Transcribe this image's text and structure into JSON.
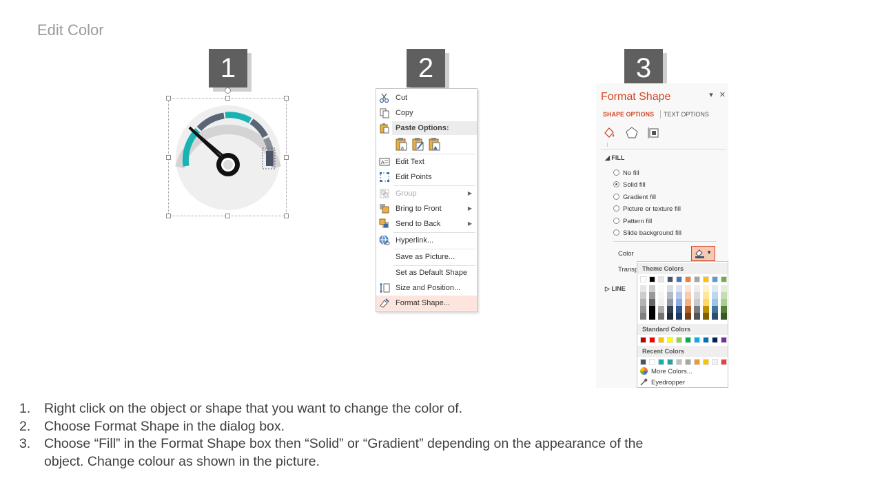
{
  "title": "Edit Color",
  "steps": [
    "1",
    "2",
    "3"
  ],
  "context_menu": {
    "items": [
      {
        "label": "Cut",
        "icon": "scissors-icon"
      },
      {
        "label": "Copy",
        "icon": "copy-icon"
      },
      {
        "label": "Paste Options:",
        "icon": "paste-icon"
      },
      {
        "label": "Edit Text",
        "icon": "edit-text-icon"
      },
      {
        "label": "Edit Points",
        "icon": "edit-points-icon"
      },
      {
        "label": "Group",
        "icon": "group-icon"
      },
      {
        "label": "Bring to Front",
        "icon": "bring-to-front-icon"
      },
      {
        "label": "Send to Back",
        "icon": "send-to-back-icon"
      },
      {
        "label": "Hyperlink...",
        "icon": "hyperlink-icon"
      },
      {
        "label": "Save as Picture...",
        "icon": ""
      },
      {
        "label": "Set as Default Shape",
        "icon": ""
      },
      {
        "label": "Size and Position...",
        "icon": "size-position-icon"
      },
      {
        "label": "Format Shape...",
        "icon": "format-shape-icon"
      }
    ]
  },
  "format_pane": {
    "title": "Format Shape",
    "tab_shape": "SHAPE OPTIONS",
    "tab_text": "TEXT OPTIONS",
    "fill_section": "FILL",
    "line_section": "LINE",
    "fill_options": [
      "No fill",
      "Solid fill",
      "Gradient fill",
      "Picture or texture fill",
      "Pattern fill",
      "Slide background fill"
    ],
    "selected_fill": "Solid fill",
    "color_label": "Color",
    "transparency_label": "Transp",
    "accent_color": "#d24726"
  },
  "color_picker": {
    "theme_header": "Theme Colors",
    "standard_header": "Standard Colors",
    "recent_header": "Recent Colors",
    "more_colors": "More Colors...",
    "eyedropper": "Eyedropper",
    "theme_top": [
      "#ffffff",
      "#000000",
      "#e7e6e6",
      "#44546a",
      "#4472c4",
      "#ed7d31",
      "#a5a5a5",
      "#ffc000",
      "#5b9bd5",
      "#70ad47"
    ],
    "standard": [
      "#c00000",
      "#ff0000",
      "#ffc000",
      "#ffff00",
      "#92d050",
      "#00b050",
      "#00b0f0",
      "#0070c0",
      "#002060",
      "#7030a0"
    ],
    "recent": [
      "#44546a",
      "#ffffff",
      "#0fb1b1",
      "#26a0a0",
      "#bfbfbf",
      "#a5a5a5",
      "#ed9a31",
      "#ffc000",
      "#f2f2f2",
      "#e84040"
    ]
  },
  "instructions": [
    {
      "num": "1.",
      "text": "Right click on the object or shape that you want to change the color of."
    },
    {
      "num": "2.",
      "text": "Choose Format Shape in the dialog box."
    },
    {
      "num": "3.",
      "text": "Choose “Fill” in the Format Shape box then “Solid” or “Gradient” depending  on the appearance of the object. Change colour as shown in the picture."
    }
  ]
}
